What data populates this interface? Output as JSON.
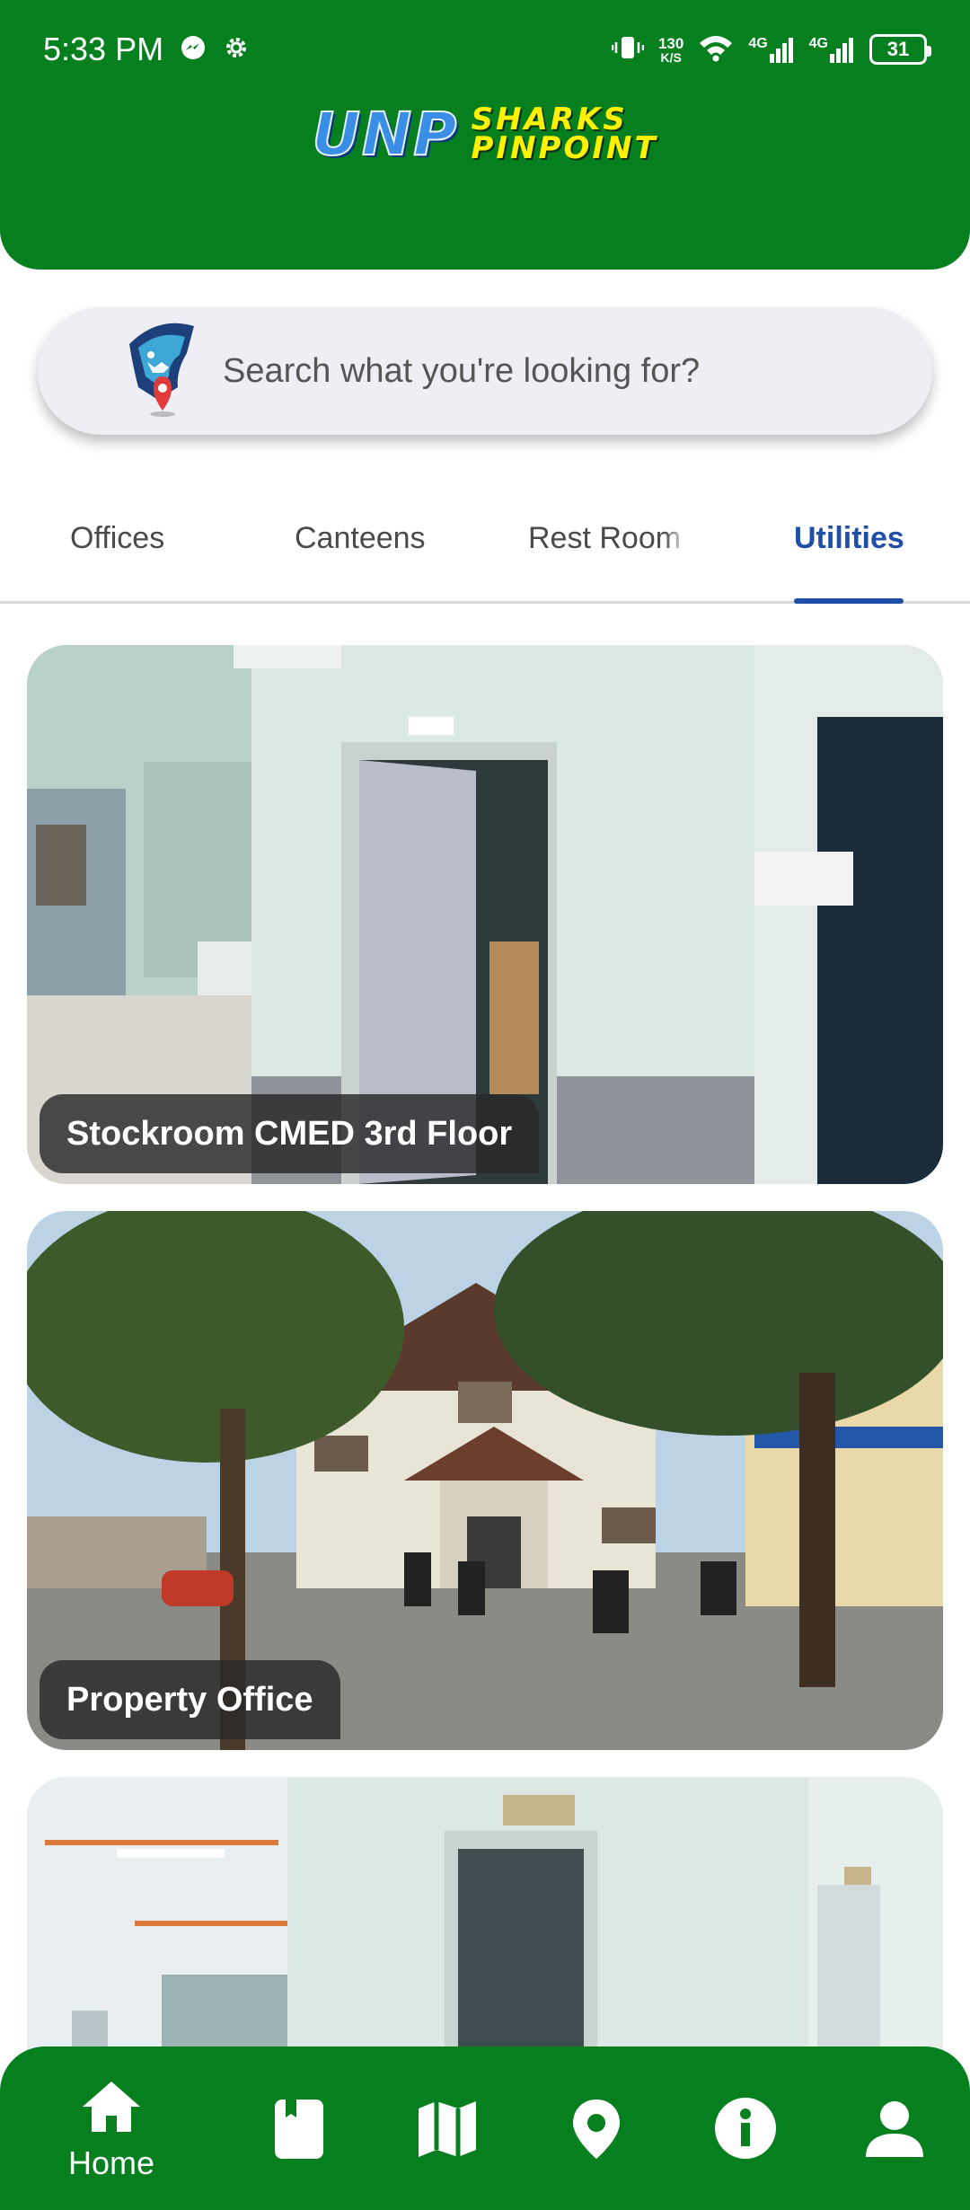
{
  "status_bar": {
    "time": "5:33 PM",
    "net_speed_value": "130",
    "net_speed_unit": "K/S",
    "signal_1": "4G",
    "signal_2": "4G",
    "battery": "31"
  },
  "app": {
    "logo_unp": "UNP",
    "logo_line1": "SHARKS",
    "logo_line2": "PINPOINT"
  },
  "search": {
    "placeholder": "Search what you're looking for?"
  },
  "tabs": [
    {
      "label": "Offices",
      "active": false
    },
    {
      "label": "Canteens",
      "active": false
    },
    {
      "label": "Rest Room",
      "active": false
    },
    {
      "label": "Utilities",
      "active": true
    }
  ],
  "cards": [
    {
      "title": "Stockroom CMED 3rd Floor"
    },
    {
      "title": "Property Office"
    },
    {
      "title": ""
    }
  ],
  "bottom_nav": {
    "items": [
      {
        "icon": "home-icon",
        "label": "Home",
        "active": true
      },
      {
        "icon": "book-icon",
        "label": ""
      },
      {
        "icon": "map-icon",
        "label": ""
      },
      {
        "icon": "location-pin-icon",
        "label": ""
      },
      {
        "icon": "info-icon",
        "label": ""
      },
      {
        "icon": "person-icon",
        "label": ""
      }
    ]
  },
  "colors": {
    "brand_green": "#067f1f",
    "active_tab": "#1f4fa6",
    "logo_yellow": "#fff200",
    "logo_blue": "#3a8ee6"
  }
}
